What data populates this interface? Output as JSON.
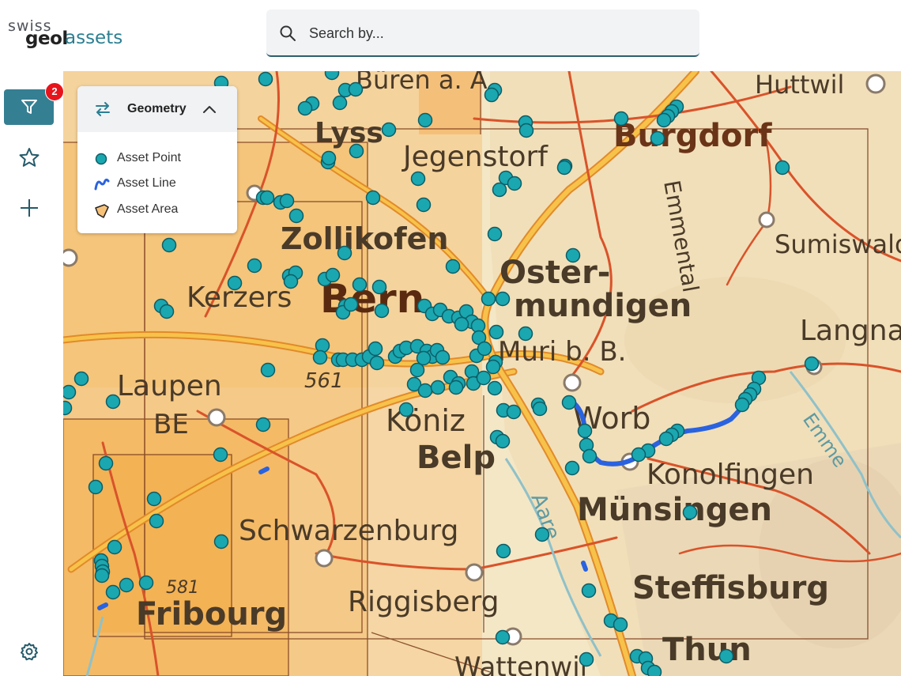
{
  "app": {
    "logo_swiss": "swiss",
    "logo_geol": "geol",
    "logo_assets": "assets"
  },
  "search": {
    "placeholder": "Search by..."
  },
  "sidebar": {
    "filter_badge": "2",
    "items": [
      {
        "name": "filter",
        "icon": "filter-icon"
      },
      {
        "name": "favorites",
        "icon": "star-icon"
      },
      {
        "name": "add",
        "icon": "plus-icon"
      },
      {
        "name": "settings",
        "icon": "gear-icon"
      }
    ]
  },
  "legend": {
    "title": "Geometry",
    "items": [
      {
        "label": "Asset Point",
        "icon": "point-icon"
      },
      {
        "label": "Asset Line",
        "icon": "line-icon"
      },
      {
        "label": "Asset Area",
        "icon": "area-icon"
      }
    ]
  },
  "map": {
    "place_labels": [
      "Huttwil",
      "Lyss",
      "Jegenstorf",
      "Burgdorf",
      "Zollikofen",
      "Sumiswald",
      "Oster-",
      "mundigen",
      "Kerzers",
      "Bern",
      "Langnau",
      "Muri b. B.",
      "Laupen",
      "BE",
      "Worb",
      "Köniz",
      "Belp",
      "Konolfingen",
      "Emme",
      "Münsingen",
      "Schwarzenburg",
      "Aare",
      "Steffisburg",
      "Riggisberg",
      "Fribourg",
      "Thun",
      "Wattenwil",
      "Büren a. A.",
      "561",
      "581",
      "Emmental"
    ],
    "colors": {
      "point_fill": "#1aa7b0",
      "point_stroke": "#0e5d66",
      "line": "#2a62e0",
      "accent": "#357f93",
      "badge": "#e8141c",
      "area_outline": "#7a3a1a"
    }
  }
}
